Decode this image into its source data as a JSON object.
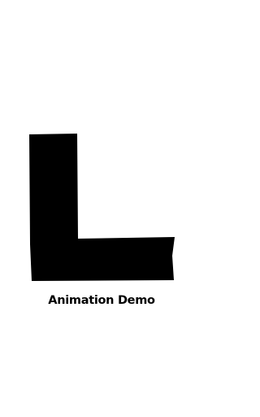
{
  "app": {
    "background_color": "#ffffff",
    "logo_color": "#000000",
    "logo_icon": "letter-l-logo",
    "caption": "Animation Demo"
  }
}
